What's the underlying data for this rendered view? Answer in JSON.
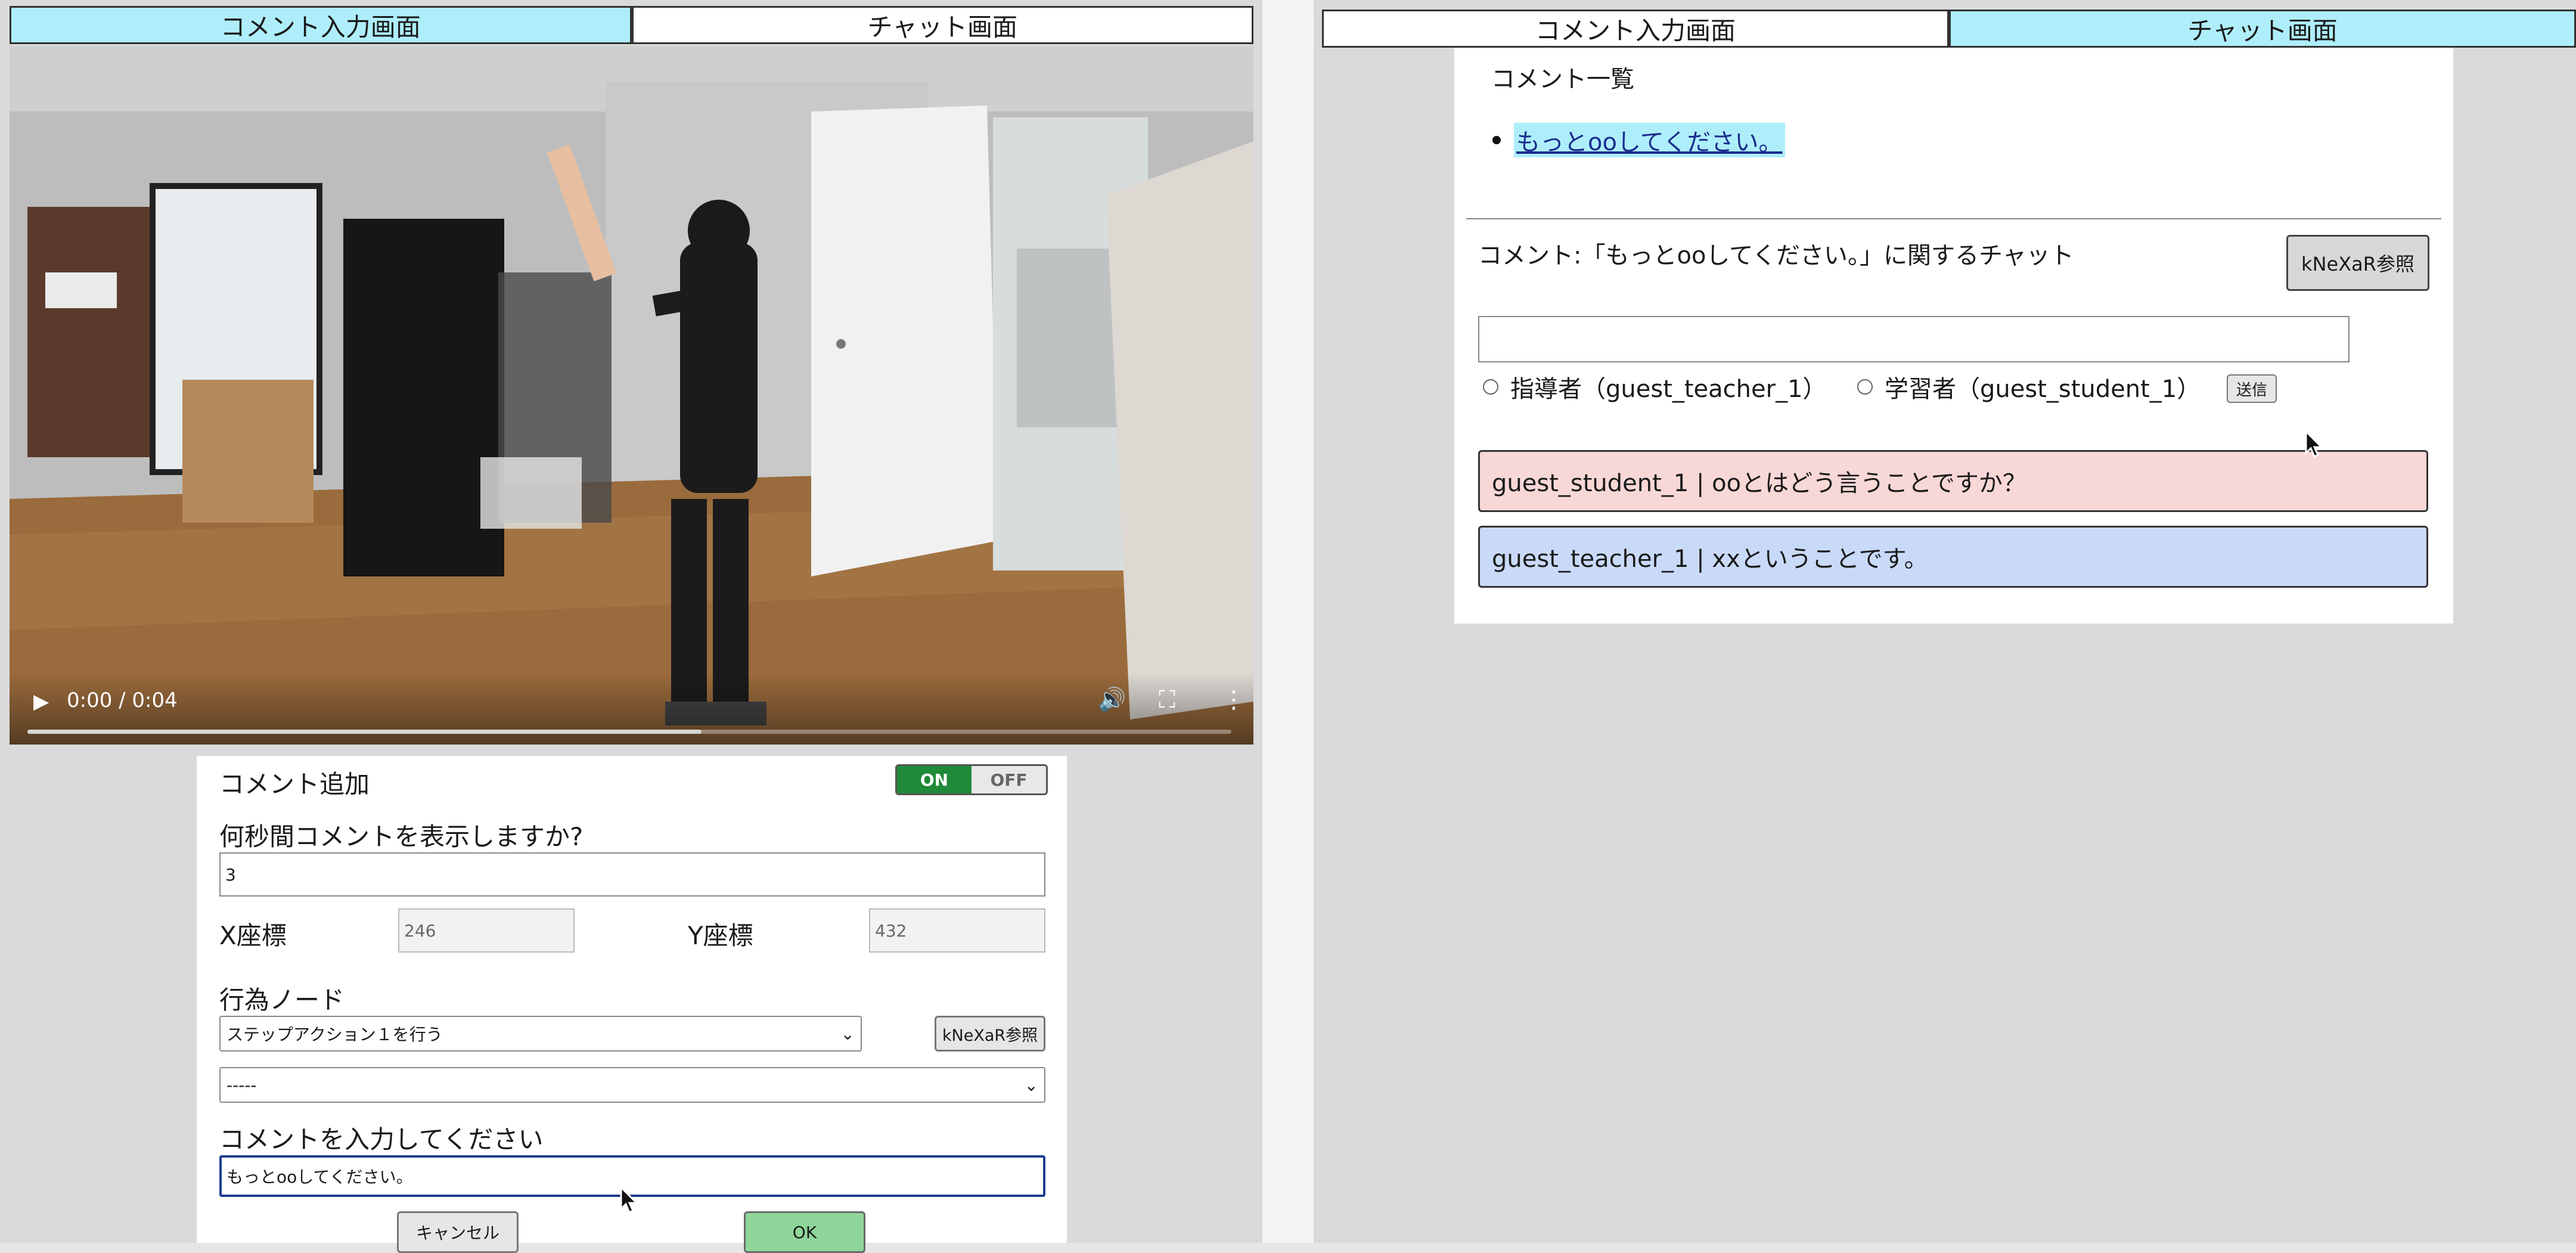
{
  "left": {
    "tabs": [
      {
        "label": "コメント入力画面",
        "active": true
      },
      {
        "label": "チャット画面",
        "active": false
      }
    ],
    "video": {
      "time": "0:00 / 0:04",
      "progress": 0.56
    },
    "form": {
      "add_comment_label": "コメント追加",
      "toggle_on": "ON",
      "toggle_off": "OFF",
      "duration_label": "何秒間コメントを表示しますか?",
      "duration_value": "3",
      "x_label": "X座標",
      "x_value": "246",
      "y_label": "Y座標",
      "y_value": "432",
      "node_label": "行為ノード",
      "node_select": "ステップアクション１を行う",
      "knexar_button": "kNeXaR参照",
      "sub_select": "-----",
      "comment_label": "コメントを入力してください",
      "comment_value": "もっとooしてください。",
      "cancel_button": "キャンセル",
      "ok_button": "OK"
    }
  },
  "right": {
    "tabs": [
      {
        "label": "コメント入力画面",
        "active": false
      },
      {
        "label": "チャット画面",
        "active": true
      }
    ],
    "list_title": "コメント一覧",
    "comments": [
      "もっとooしてください。"
    ],
    "chat_title": "コメント:「もっとooしてください。」に関するチャット",
    "knexar_button": "kNeXaR参照",
    "message_input": "",
    "roles": [
      {
        "label": "指導者（guest_teacher_1）"
      },
      {
        "label": "学習者（guest_student_1）"
      }
    ],
    "send_button": "送信",
    "messages": [
      {
        "text": "guest_student_1 | ooとはどう言うことですか？",
        "role": "student"
      },
      {
        "text": "guest_teacher_1 | xxということです。",
        "role": "teacher"
      }
    ]
  },
  "colors": {
    "tab_active": "#aeeefa",
    "student_bubble": "#f8d7d7",
    "teacher_bubble": "#c9daf8",
    "ok_button": "#8fd69a",
    "toggle_on": "#1f8a3a"
  }
}
